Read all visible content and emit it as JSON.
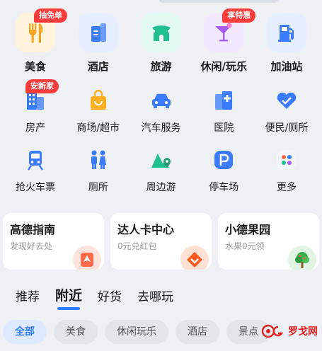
{
  "grid": {
    "row1": [
      {
        "label": "美食",
        "icon": "food-icon",
        "badge": "抽免单",
        "bg": "#fff3dd",
        "color": "#f5a623"
      },
      {
        "label": "酒店",
        "icon": "hotel-icon",
        "badge": "",
        "bg": "#e7efff",
        "color": "#3b7bff"
      },
      {
        "label": "旅游",
        "icon": "travel-gate-icon",
        "badge": "",
        "bg": "#e1f8f1",
        "color": "#1fbf8f"
      },
      {
        "label": "休闲/玩乐",
        "icon": "cocktail-icon",
        "badge": "享特惠",
        "bg": "#f3e9ff",
        "color": "#a85cf0"
      },
      {
        "label": "加油站",
        "icon": "gas-pump-icon",
        "badge": "",
        "bg": "#e6efff",
        "color": "#3b7bff"
      }
    ],
    "row2": [
      {
        "label": "房产",
        "icon": "building-icon",
        "badge": "安新家",
        "color": "#3b7bff"
      },
      {
        "label": "商场/超市",
        "icon": "shopping-bag-icon",
        "badge": "",
        "color": "#ffb020"
      },
      {
        "label": "汽车服务",
        "icon": "car-icon",
        "badge": "",
        "color": "#3b7bff"
      },
      {
        "label": "医院",
        "icon": "hospital-icon",
        "badge": "",
        "color": "#3b7bff"
      },
      {
        "label": "便民/厕所",
        "icon": "heart-hands-icon",
        "badge": "",
        "color": "#3b7bff"
      }
    ],
    "row3": [
      {
        "label": "抢火车票",
        "icon": "train-icon",
        "badge": "",
        "color": "#3b7bff"
      },
      {
        "label": "厕所",
        "icon": "restroom-icon",
        "badge": "",
        "color": "#3b7bff"
      },
      {
        "label": "周边游",
        "icon": "nearby-trip-icon",
        "badge": "",
        "color": "#1fbf8f"
      },
      {
        "label": "停车场",
        "icon": "parking-icon",
        "badge": "",
        "color": "#3b7bff"
      },
      {
        "label": "更多",
        "icon": "more-dots-icon",
        "badge": "",
        "color": "#999999"
      }
    ]
  },
  "cards": [
    {
      "title": "高德指南",
      "subtitle": "发现好去处",
      "icon": "guide-icon",
      "color": "#ff6b4a"
    },
    {
      "title": "达人卡中心",
      "subtitle": "0元兑红包",
      "icon": "badge-card-icon",
      "color": "#ff5a1f"
    },
    {
      "title": "小德果园",
      "subtitle": "水果0元领",
      "icon": "tree-icon",
      "color": "#36b24a"
    }
  ],
  "feed_tabs": [
    {
      "label": "推荐",
      "active": false
    },
    {
      "label": "附近",
      "active": true
    },
    {
      "label": "好货",
      "active": false
    },
    {
      "label": "去哪玩",
      "active": false
    }
  ],
  "chips": [
    "全部",
    "美食",
    "休闲玩乐",
    "酒店",
    "景点"
  ],
  "watermark": "罗戈网",
  "colors": {
    "accent": "#2e7dff",
    "badge": "#ff3c3c"
  }
}
